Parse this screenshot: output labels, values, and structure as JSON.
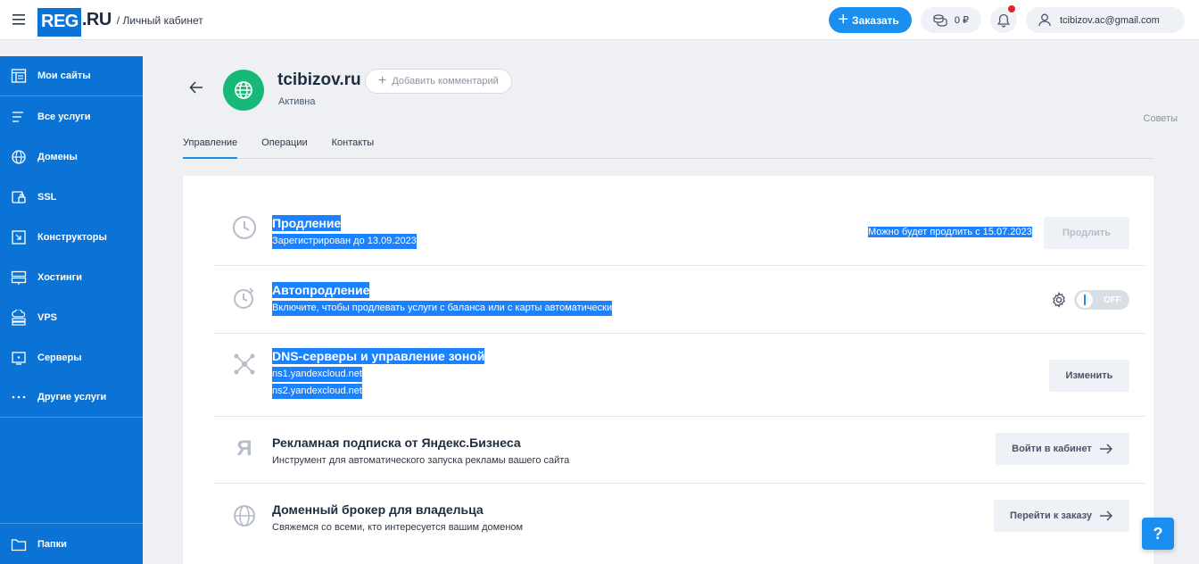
{
  "header": {
    "logo_reg": "REG",
    "logo_ru": ".RU",
    "logo_sub": "/ Личный кабинет",
    "order_label": "Заказать",
    "balance": "0 ₽",
    "user_email": "tcibizov.ac@gmail.com"
  },
  "sidebar": {
    "items": [
      {
        "label": "Мои сайты",
        "icon": "sites-icon"
      },
      {
        "label": "Все услуги",
        "icon": "list-icon"
      },
      {
        "label": "Домены",
        "icon": "globe-icon"
      },
      {
        "label": "SSL",
        "icon": "ssl-icon"
      },
      {
        "label": "Конструкторы",
        "icon": "builder-icon"
      },
      {
        "label": "Хостинги",
        "icon": "hosting-icon"
      },
      {
        "label": "VPS",
        "icon": "vps-icon"
      },
      {
        "label": "Серверы",
        "icon": "server-icon"
      },
      {
        "label": "Другие услуги",
        "icon": "more-icon"
      }
    ],
    "bottom_label": "Папки"
  },
  "domain": {
    "name": "tcibizov.ru",
    "status": "Активна",
    "add_comment": "Добавить комментарий",
    "tips": "Советы"
  },
  "tabs": [
    "Управление",
    "Операции",
    "Контакты"
  ],
  "rows": {
    "renewal": {
      "title": "Продление",
      "subtitle": "Зарегистрирован до 13.09.2023",
      "note": "Можно будет продлить с 15.07.2023",
      "button": "Продлить"
    },
    "autorenew": {
      "title": "Автопродление",
      "subtitle": "Включите, чтобы продлевать услуги с баланса или с карты автоматически",
      "toggle": "OFF"
    },
    "dns": {
      "title": "DNS-серверы и управление зоной",
      "ns1": "ns1.yandexcloud.net",
      "ns2": "ns2.yandexcloud.net",
      "button": "Изменить"
    },
    "yandex": {
      "title": "Рекламная подписка от Яндекс.Бизнеса",
      "subtitle": "Инструмент для автоматического запуска рекламы вашего сайта",
      "button": "Войти в кабинет",
      "icon_letter": "Я"
    },
    "broker": {
      "title": "Доменный брокер для владельца",
      "subtitle": "Свяжемся со всеми, кто интересуется вашим доменом",
      "button": "Перейти к заказу"
    }
  },
  "help_label": "?",
  "colors": {
    "brand": "#0b72d6",
    "accent": "#1a8ff0",
    "success": "#17b978",
    "selection": "#1a82ff"
  }
}
